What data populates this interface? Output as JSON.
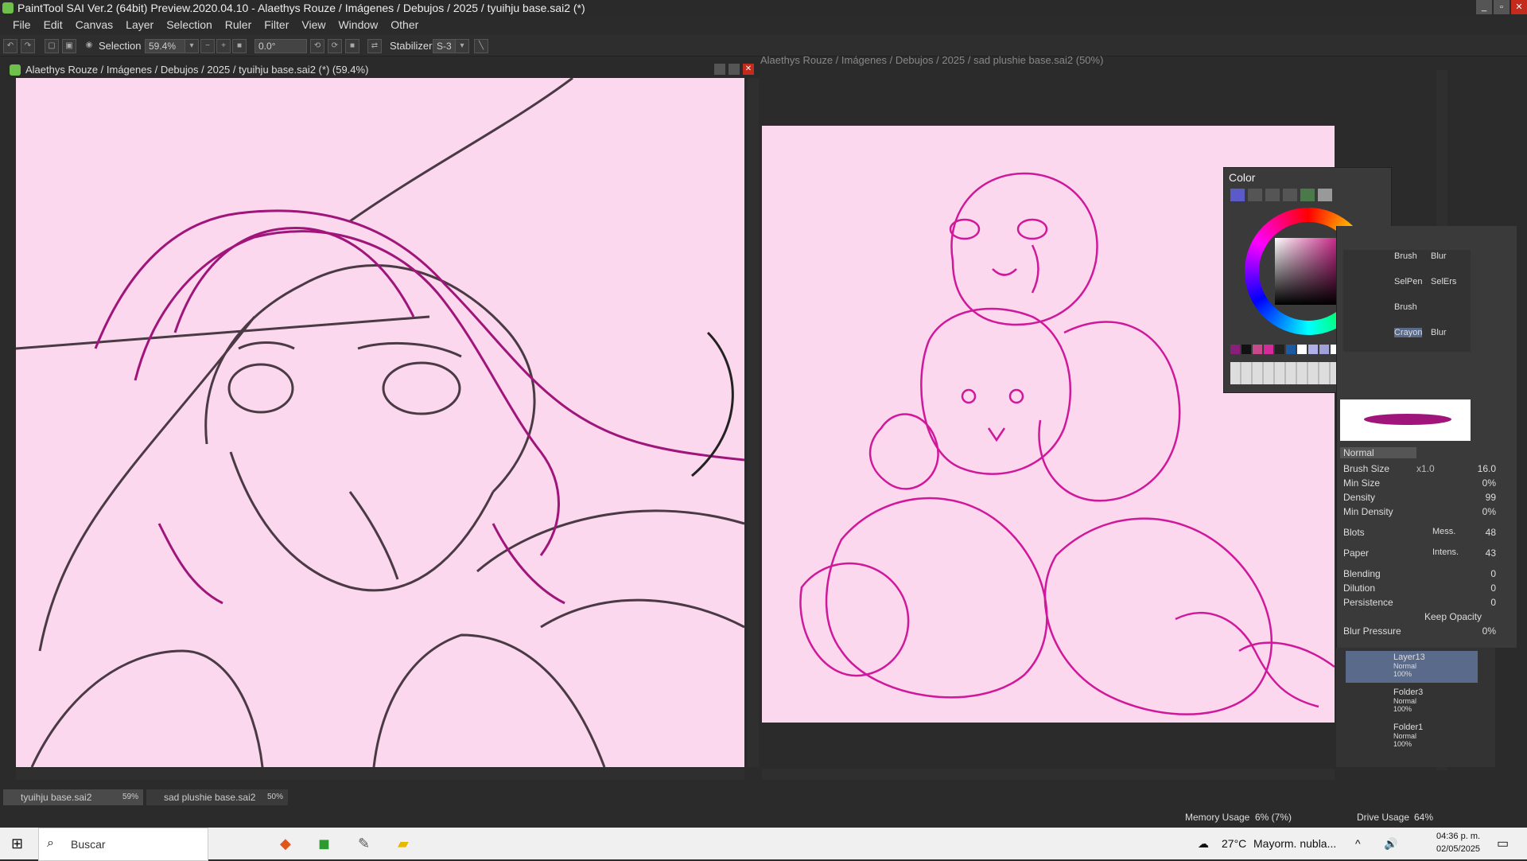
{
  "app": {
    "title": "PaintTool SAI Ver.2 (64bit) Preview.2020.04.10 - Alaethys Rouze / Imágenes / Debujos / 2025 / tyuihju base.sai2 (*)"
  },
  "menu": [
    "File",
    "Edit",
    "Canvas",
    "Layer",
    "Selection",
    "Ruler",
    "Filter",
    "View",
    "Window",
    "Other"
  ],
  "toolbar": {
    "selection_label": "Selection",
    "zoom": "59.4%",
    "rotation": "0.0°",
    "stabilizer_label": "Stabilizer",
    "stabilizer_value": "S-3"
  },
  "doc1": {
    "title": "Alaethys Rouze / Imágenes / Debujos / 2025 / tyuihju base.sai2 (*) (59.4%)"
  },
  "doc2": {
    "title": "Alaethys Rouze / Imágenes / Debujos / 2025 / sad plushie base.sai2 (50%)"
  },
  "color_panel": {
    "title": "Color",
    "swatches": [
      "#8a1f7a",
      "#111111",
      "#c84a8a",
      "#d42a9a",
      "#222222",
      "#1d5aa0",
      "#ffffff",
      "#b0b0e8",
      "#a0a0d8",
      "#ffffff",
      "#ffffff",
      "#ffffff",
      "#3a2a60"
    ],
    "accent": "#c3177f"
  },
  "tool_panel": {
    "tools": [
      [
        "Brush",
        "Blur"
      ],
      [
        "SelPen",
        "SelErs"
      ],
      [
        "Brush",
        ""
      ],
      [
        "Crayon",
        "Blur"
      ]
    ],
    "blend_mode": "Normal",
    "props": [
      {
        "label": "Brush Size",
        "prefix": "x1.0",
        "value": "16.0"
      },
      {
        "label": "Min Size",
        "value": "0%"
      },
      {
        "label": "Density",
        "value": "99"
      },
      {
        "label": "Min Density",
        "value": "0%"
      }
    ],
    "blots": {
      "label": "Blots",
      "mode": "Mess.",
      "value": "48"
    },
    "paper": {
      "label": "Paper",
      "mode": "Intens.",
      "value": "43"
    },
    "mix": [
      {
        "label": "Blending",
        "value": "0"
      },
      {
        "label": "Dilution",
        "value": "0"
      },
      {
        "label": "Persistence",
        "value": "0"
      }
    ],
    "keep_opacity": "Keep Opacity",
    "blur_pressure": {
      "label": "Blur Pressure",
      "value": "0%"
    }
  },
  "layers": [
    {
      "name": "Layer13",
      "mode": "Normal",
      "opacity": "100%"
    },
    {
      "name": "Folder3",
      "mode": "Normal",
      "opacity": "100%"
    },
    {
      "name": "Folder1",
      "mode": "Normal",
      "opacity": "100%"
    }
  ],
  "doc_tabs": [
    {
      "name": "tyuihju base.sai2",
      "zoom": "59%"
    },
    {
      "name": "sad plushie base.sai2",
      "zoom": "50%"
    }
  ],
  "status": {
    "memory_label": "Memory Usage",
    "memory_value": "6% (7%)",
    "drive_label": "Drive Usage",
    "drive_value": "64%"
  },
  "taskbar": {
    "search_placeholder": "Buscar",
    "weather_temp": "27°C",
    "weather_text": "Mayorm. nubla...",
    "time": "04:36 p. m.",
    "date": "02/05/2025"
  }
}
